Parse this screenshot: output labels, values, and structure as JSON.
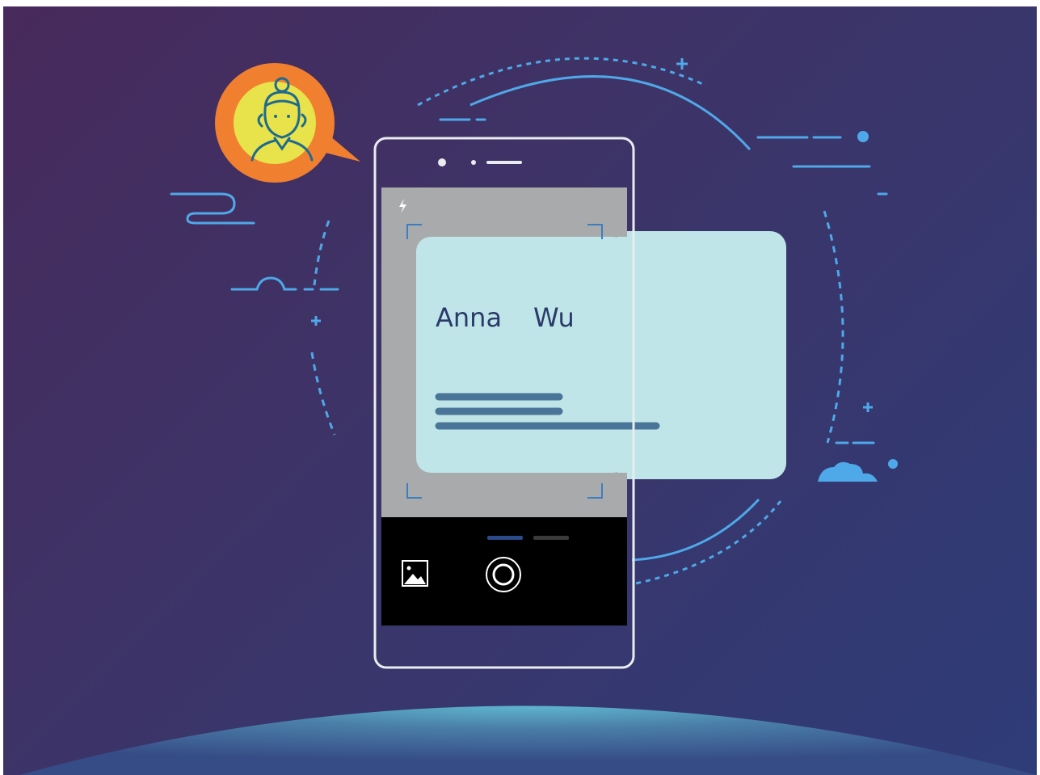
{
  "card": {
    "first_name": "Anna",
    "last_name": "Wu"
  },
  "camera": {
    "mode_labels": [
      "",
      ""
    ]
  },
  "colors": {
    "accent_blue": "#4fa8e8",
    "card_bg": "#bfe5e8",
    "avatar_bubble": "#f08030",
    "avatar_face_bg": "#e8e34a",
    "viewfinder_bg": "#a9aaab",
    "camera_bar": "#000000"
  },
  "icons": {
    "flash": "flash-icon",
    "gallery": "gallery-icon",
    "shutter": "shutter-button",
    "avatar": "avatar-icon"
  }
}
